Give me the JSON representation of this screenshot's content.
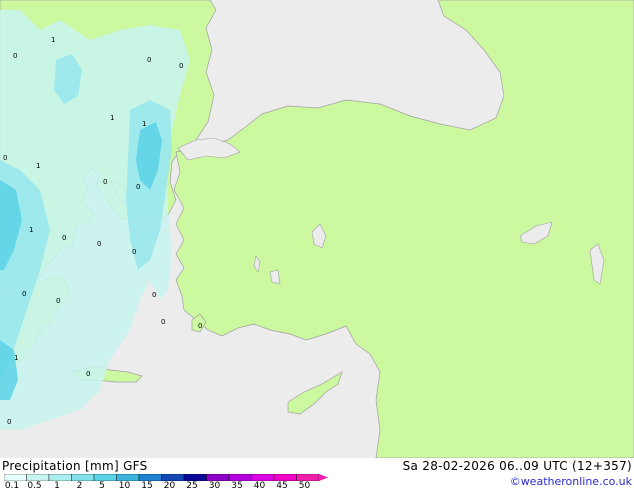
{
  "map": {
    "colors": {
      "sea": "#ececec",
      "land": "#ccf8a0",
      "coast": "#a0a0a0",
      "precip_light": "#c8f5f0",
      "precip_medium": "#96e6ec",
      "precip_heavy": "#5ad2e6"
    },
    "precip_labels": [
      "1",
      "1",
      "1",
      "1",
      "1",
      "1",
      "0",
      "0",
      "0",
      "0",
      "0",
      "0",
      "0",
      "0",
      "0",
      "0",
      "0",
      "0",
      "0",
      "0",
      "0",
      "0"
    ]
  },
  "footer": {
    "title": "Precipitation [mm] GFS",
    "validity": "Sa 28-02-2026 06..09 UTC (12+357)",
    "credit": "©weatheronline.co.uk"
  },
  "colorbar": {
    "labels": [
      "0.1",
      "0.5",
      "1",
      "2",
      "5",
      "10",
      "15",
      "20",
      "25",
      "30",
      "35",
      "40",
      "45",
      "50"
    ],
    "colors": [
      "#e6fffe",
      "#c8f5f0",
      "#aaeeee",
      "#82e0ea",
      "#5ad2e6",
      "#3cb4dc",
      "#1e82d2",
      "#1446b4",
      "#0a0a96",
      "#8c00c8",
      "#b400dc",
      "#dc00e6",
      "#f000c8",
      "#f01eaa"
    ]
  }
}
